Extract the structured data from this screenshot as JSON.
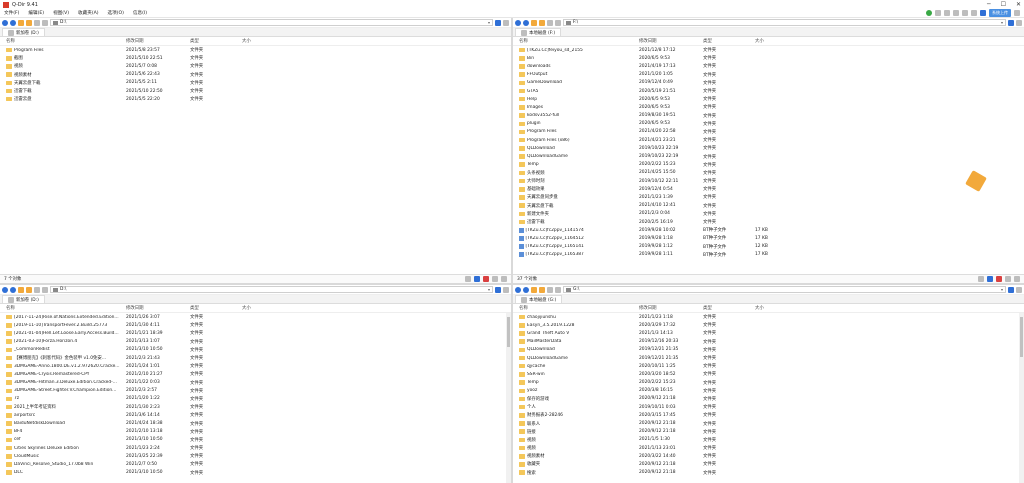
{
  "window": {
    "title": "Q-Dir 9.41"
  },
  "menu": [
    "文件(F)",
    "编辑(E)",
    "视图(V)",
    "收藏夹(A)",
    "选项(O)",
    "信息(I)"
  ],
  "top_right_badge": "系统上传",
  "panes": [
    {
      "path": "D:\\",
      "tab": "新加卷 (D:)",
      "headers": [
        "名称",
        "修改日期",
        "类型",
        "大小"
      ],
      "rows": [
        {
          "name": "Program Files",
          "date": "2021/5/8 23:57",
          "type": "文件夹",
          "size": "",
          "kind": "folder"
        },
        {
          "name": "截图",
          "date": "2021/5/10 22:51",
          "type": "文件夹",
          "size": "",
          "kind": "folder"
        },
        {
          "name": "视频",
          "date": "2021/5/7 0:08",
          "type": "文件夹",
          "size": "",
          "kind": "folder"
        },
        {
          "name": "视频素材",
          "date": "2021/5/6 22:43",
          "type": "文件夹",
          "size": "",
          "kind": "folder"
        },
        {
          "name": "天翼云盘下载",
          "date": "2021/5/5 2:11",
          "type": "文件夹",
          "size": "",
          "kind": "folder"
        },
        {
          "name": "迅雷下载",
          "date": "2021/5/10 22:50",
          "type": "文件夹",
          "size": "",
          "kind": "folder"
        },
        {
          "name": "迅雷云盘",
          "date": "2021/5/5 22:20",
          "type": "文件夹",
          "size": "",
          "kind": "folder"
        }
      ],
      "status": "7 个对象"
    },
    {
      "path": "F:\\",
      "tab": "本地磁盘 (F:)",
      "headers": [
        "名称",
        "修改日期",
        "类型",
        "大小"
      ],
      "rows": [
        {
          "name": "[TKZu.Cc]feiyou_sd_2155",
          "date": "2021/12/8 17:12",
          "type": "文件夹",
          "size": "",
          "kind": "folder"
        },
        {
          "name": "Bin",
          "date": "2020/6/5 9:53",
          "type": "文件夹",
          "size": "",
          "kind": "folder"
        },
        {
          "name": "downloads",
          "date": "2021/4/19 17:13",
          "type": "文件夹",
          "size": "",
          "kind": "folder"
        },
        {
          "name": "FFOutput",
          "date": "2021/1/20 1:05",
          "type": "文件夹",
          "size": "",
          "kind": "folder"
        },
        {
          "name": "GameDownload",
          "date": "2019/12/4 0:49",
          "type": "文件夹",
          "size": "",
          "kind": "folder"
        },
        {
          "name": "GTA5",
          "date": "2020/5/19 21:51",
          "type": "文件夹",
          "size": "",
          "kind": "folder"
        },
        {
          "name": "Help",
          "date": "2020/6/5 9:53",
          "type": "文件夹",
          "size": "",
          "kind": "folder"
        },
        {
          "name": "Images",
          "date": "2020/6/5 9:53",
          "type": "文件夹",
          "size": "",
          "kind": "folder"
        },
        {
          "name": "kodsv3552-full",
          "date": "2019/8/30 19:51",
          "type": "文件夹",
          "size": "",
          "kind": "folder"
        },
        {
          "name": "plugin",
          "date": "2020/6/5 9:53",
          "type": "文件夹",
          "size": "",
          "kind": "folder"
        },
        {
          "name": "Program Files",
          "date": "2021/4/20 22:58",
          "type": "文件夹",
          "size": "",
          "kind": "folder"
        },
        {
          "name": "Program Files (x86)",
          "date": "2021/4/21 23:21",
          "type": "文件夹",
          "size": "",
          "kind": "folder"
        },
        {
          "name": "QLDownload",
          "date": "2019/10/23 22:19",
          "type": "文件夹",
          "size": "",
          "kind": "folder"
        },
        {
          "name": "QLDownloadGame",
          "date": "2019/10/23 22:19",
          "type": "文件夹",
          "size": "",
          "kind": "folder"
        },
        {
          "name": "Temp",
          "date": "2020/2/22 15:23",
          "type": "文件夹",
          "size": "",
          "kind": "folder"
        },
        {
          "name": "头条视频",
          "date": "2021/4/25 15:50",
          "type": "文件夹",
          "size": "",
          "kind": "folder"
        },
        {
          "name": "大师时刻",
          "date": "2019/10/12 22:11",
          "type": "文件夹",
          "size": "",
          "kind": "folder"
        },
        {
          "name": "基础效果",
          "date": "2019/12/4 0:54",
          "type": "文件夹",
          "size": "",
          "kind": "folder"
        },
        {
          "name": "天翼云盘同步盘",
          "date": "2021/1/23 1:39",
          "type": "文件夹",
          "size": "",
          "kind": "folder"
        },
        {
          "name": "天翼云盘下载",
          "date": "2021/4/10 12:41",
          "type": "文件夹",
          "size": "",
          "kind": "folder"
        },
        {
          "name": "新建文件夹",
          "date": "2021/2/3 0:04",
          "type": "文件夹",
          "size": "",
          "kind": "folder"
        },
        {
          "name": "迅雷下载",
          "date": "2020/2/5 16:19",
          "type": "文件夹",
          "size": "",
          "kind": "folder"
        },
        {
          "name": "[TKZu.Cc]fc2ppv_1141574",
          "date": "2019/9/28 10:02",
          "type": "BT种子文件",
          "size": "17 KB",
          "kind": "file"
        },
        {
          "name": "[TKZu.Cc]fc2ppv_1164512",
          "date": "2019/9/28 1:18",
          "type": "BT种子文件",
          "size": "17 KB",
          "kind": "file"
        },
        {
          "name": "[TKZu.Cc]fc2ppv_1165141",
          "date": "2019/9/28 1:12",
          "type": "BT种子文件",
          "size": "12 KB",
          "kind": "file"
        },
        {
          "name": "[TKZu.Cc]fc2ppv_1165387",
          "date": "2019/9/28 1:11",
          "type": "BT种子文件",
          "size": "17 KB",
          "kind": "file"
        }
      ],
      "status": "37 个对象"
    },
    {
      "path": "D:\\",
      "tab": "新加卷 (D:)",
      "headers": [
        "名称",
        "修改日期",
        "类型",
        "大小"
      ],
      "rows": [
        {
          "name": "[2017-11-24]Rise.of.Nations.Extended.Edition...",
          "date": "2021/1/26 3:07",
          "type": "文件夹",
          "size": "",
          "kind": "folder"
        },
        {
          "name": "[2019-11-10]TransportFever.2.Build.25773",
          "date": "2021/1/30 4:11",
          "type": "文件夹",
          "size": "",
          "kind": "folder"
        },
        {
          "name": "[2021-01-04]Hell.Let.Loose.Early.Access.Build...",
          "date": "2021/1/21 18:39",
          "type": "文件夹",
          "size": "",
          "kind": "folder"
        },
        {
          "name": "[2021-03-10]Forza.Horizon.4",
          "date": "2021/3/13 1:07",
          "type": "文件夹",
          "size": "",
          "kind": "folder"
        },
        {
          "name": "_CommonRedist",
          "date": "2021/3/10 10:50",
          "type": "文件夹",
          "size": "",
          "kind": "folder"
        },
        {
          "name": "【赛博朋克】《刺客代码》金色装甲 v1.0免安...",
          "date": "2021/2/3 21:43",
          "type": "文件夹",
          "size": "",
          "kind": "folder"
        },
        {
          "name": "3DMGAME-Anno.1800.DE.v1.2.972620.Cracke...",
          "date": "2021/1/24 1:01",
          "type": "文件夹",
          "size": "",
          "kind": "folder"
        },
        {
          "name": "3DMGAME-Crysis.Remastered-CPY",
          "date": "2021/2/10 21:27",
          "type": "文件夹",
          "size": "",
          "kind": "folder"
        },
        {
          "name": "3DMGAME-Hitman.3.Deluxe.Edition.Cracked-...",
          "date": "2021/1/22 0:03",
          "type": "文件夹",
          "size": "",
          "kind": "folder"
        },
        {
          "name": "3DMGAME-Street.Fighter.V.Champion.Edition...",
          "date": "2021/2/3 2:57",
          "type": "文件夹",
          "size": "",
          "kind": "folder"
        },
        {
          "name": "7z",
          "date": "2021/1/20 1:22",
          "type": "文件夹",
          "size": "",
          "kind": "folder"
        },
        {
          "name": "2021上半年考证资料",
          "date": "2021/1/30 2:23",
          "type": "文件夹",
          "size": "",
          "kind": "folder"
        },
        {
          "name": "airportsrc",
          "date": "2021/3/6 14:14",
          "type": "文件夹",
          "size": "",
          "kind": "folder"
        },
        {
          "name": "BaiduNetdiskDownload",
          "date": "2021/4/24 18:38",
          "type": "文件夹",
          "size": "",
          "kind": "folder"
        },
        {
          "name": "BF4",
          "date": "2021/2/10 13:18",
          "type": "文件夹",
          "size": "",
          "kind": "folder"
        },
        {
          "name": "cef",
          "date": "2021/3/10 10:50",
          "type": "文件夹",
          "size": "",
          "kind": "folder"
        },
        {
          "name": "Cities Skylines Deluxe Edition",
          "date": "2021/1/23 2:24",
          "type": "文件夹",
          "size": "",
          "kind": "folder"
        },
        {
          "name": "CloudMusic",
          "date": "2021/3/25 22:39",
          "type": "文件夹",
          "size": "",
          "kind": "folder"
        },
        {
          "name": "DaVinci_Resolve_Studio_17.0b8 Win",
          "date": "2021/2/7 0:50",
          "type": "文件夹",
          "size": "",
          "kind": "folder"
        },
        {
          "name": "DLC",
          "date": "2021/3/10 10:50",
          "type": "文件夹",
          "size": "",
          "kind": "folder"
        }
      ],
      "status": ""
    },
    {
      "path": "G:\\",
      "tab": "本地磁盘 (G:)",
      "headers": [
        "名称",
        "修改日期",
        "类型",
        "大小"
      ],
      "rows": [
        {
          "name": "chaojijiunshu",
          "date": "2021/1/23 1:18",
          "type": "文件夹",
          "size": "",
          "kind": "folder"
        },
        {
          "name": "Easyn_3.5.2019.1228",
          "date": "2020/3/29 17:32",
          "type": "文件夹",
          "size": "",
          "kind": "folder"
        },
        {
          "name": "Grand Theft Auto V",
          "date": "2021/1/3 14:13",
          "type": "文件夹",
          "size": "",
          "kind": "folder"
        },
        {
          "name": "MailMasterData",
          "date": "2019/12/16 20:33",
          "type": "文件夹",
          "size": "",
          "kind": "folder"
        },
        {
          "name": "QLDownload",
          "date": "2019/12/21 21:35",
          "type": "文件夹",
          "size": "",
          "kind": "folder"
        },
        {
          "name": "QLDownloadGame",
          "date": "2019/12/21 21:35",
          "type": "文件夹",
          "size": "",
          "kind": "folder"
        },
        {
          "name": "qycache",
          "date": "2020/10/11 1:25",
          "type": "文件夹",
          "size": "",
          "kind": "folder"
        },
        {
          "name": "SSR-win",
          "date": "2020/3/20 18:52",
          "type": "文件夹",
          "size": "",
          "kind": "folder"
        },
        {
          "name": "Temp",
          "date": "2020/2/22 15:23",
          "type": "文件夹",
          "size": "",
          "kind": "folder"
        },
        {
          "name": "yooz",
          "date": "2020/3/8 16:15",
          "type": "文件夹",
          "size": "",
          "kind": "folder"
        },
        {
          "name": "保存的游戏",
          "date": "2020/9/12 21:18",
          "type": "文件夹",
          "size": "",
          "kind": "folder"
        },
        {
          "name": "个人",
          "date": "2019/10/11 0:03",
          "type": "文件夹",
          "size": "",
          "kind": "folder"
        },
        {
          "name": "财务报表2-28246",
          "date": "2020/3/15 17:45",
          "type": "文件夹",
          "size": "",
          "kind": "folder"
        },
        {
          "name": "联系人",
          "date": "2020/9/12 21:18",
          "type": "文件夹",
          "size": "",
          "kind": "folder"
        },
        {
          "name": "链接",
          "date": "2020/9/12 21:18",
          "type": "文件夹",
          "size": "",
          "kind": "folder"
        },
        {
          "name": "视频",
          "date": "2021/1/5 1:30",
          "type": "文件夹",
          "size": "",
          "kind": "folder"
        },
        {
          "name": "视频",
          "date": "2021/1/13 23:01",
          "type": "文件夹",
          "size": "",
          "kind": "folder"
        },
        {
          "name": "视频素材",
          "date": "2020/3/22 14:40",
          "type": "文件夹",
          "size": "",
          "kind": "folder"
        },
        {
          "name": "收藏夹",
          "date": "2020/9/12 21:18",
          "type": "文件夹",
          "size": "",
          "kind": "folder"
        },
        {
          "name": "搜索",
          "date": "2020/9/12 21:18",
          "type": "文件夹",
          "size": "",
          "kind": "folder"
        }
      ],
      "status": ""
    }
  ]
}
